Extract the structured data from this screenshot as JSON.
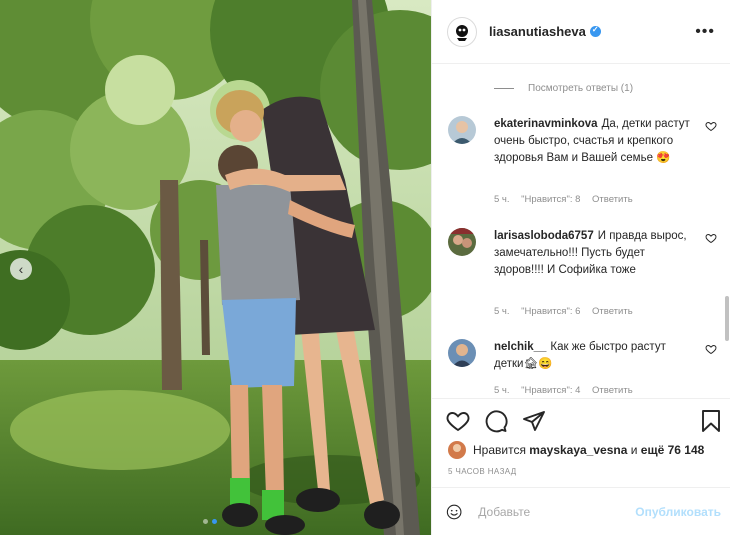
{
  "post": {
    "username": "liasanutiasheva",
    "more_icon": "more-horizontal-icon",
    "view_replies": "Посмотреть ответы (1)",
    "likes_prefix": "Нравится",
    "likes_user": "mayskaya_vesna",
    "likes_mid": "и",
    "likes_count": "ещё 76 148",
    "time_ago": "5 ЧАСОВ НАЗАД",
    "comment_placeholder": "Добавьте",
    "publish_label": "Опубликовать"
  },
  "comments": [
    {
      "user": "ekaterinavminkova",
      "text": "Да, детки растут очень быстро, счастья и крепкого здоровья Вам и Вашей семье 😍",
      "time": "5 ч.",
      "likes": "\"Нравится\": 8",
      "reply": "Ответить"
    },
    {
      "user": "larisasloboda6757",
      "text": "И правда вырос, замечательно!!! Пусть будет здоров!!!! И Софийка тоже",
      "time": "5 ч.",
      "likes": "\"Нравится\": 6",
      "reply": "Ответить"
    },
    {
      "user": "nelchik__",
      "text": "Как же быстро растут детки🏚😄",
      "time": "5 ч.",
      "likes": "\"Нравится\": 4",
      "reply": "Ответить"
    }
  ],
  "carousel": {
    "total": 2,
    "active": 1
  },
  "colors": {
    "accent": "#3897f0",
    "text": "#262626",
    "muted": "#8e8e8e",
    "post_disabled": "#b2dffc"
  }
}
